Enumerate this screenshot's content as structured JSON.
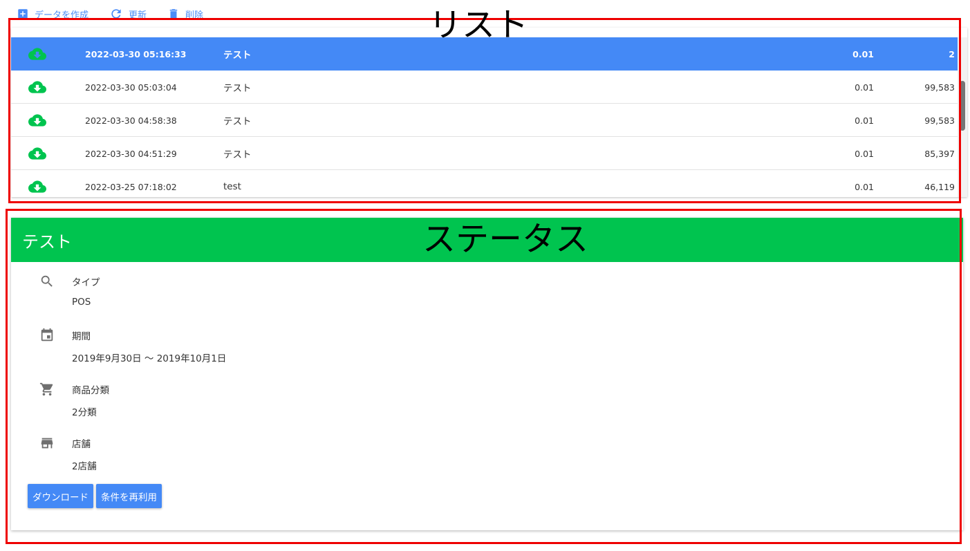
{
  "toolbar": {
    "create_label": "データを作成",
    "refresh_label": "更新",
    "delete_label": "削除"
  },
  "list": {
    "rows": [
      {
        "date": "2022-03-30 05:16:33",
        "name": "テスト",
        "value1": "0.01",
        "value2": "2",
        "selected": true
      },
      {
        "date": "2022-03-30 05:03:04",
        "name": "テスト",
        "value1": "0.01",
        "value2": "99,583"
      },
      {
        "date": "2022-03-30 04:58:38",
        "name": "テスト",
        "value1": "0.01",
        "value2": "99,583"
      },
      {
        "date": "2022-03-30 04:51:29",
        "name": "テスト",
        "value1": "0.01",
        "value2": "85,397"
      },
      {
        "date": "2022-03-25 07:18:02",
        "name": "test",
        "value1": "0.01",
        "value2": "46,119"
      }
    ]
  },
  "status": {
    "title": "テスト",
    "fields": {
      "type": {
        "label": "タイプ",
        "value": "POS"
      },
      "period": {
        "label": "期間",
        "value": "2019年9月30日 〜 2019年10月1日"
      },
      "category": {
        "label": "商品分類",
        "value": "2分類"
      },
      "store": {
        "label": "店舗",
        "value": "2店舗"
      }
    },
    "download_label": "ダウンロード",
    "reuse_label": "条件を再利用"
  },
  "annotations": {
    "list_label": "リスト",
    "status_label": "ステータス",
    "color": "#ee0000"
  },
  "colors": {
    "accent": "#4489f6",
    "status_header": "#00c44f",
    "download_icon": "#00c44f"
  },
  "icons": [
    "add-box-icon",
    "refresh-icon",
    "trash-icon",
    "cloud-download-icon",
    "search-icon",
    "calendar-icon",
    "cart-icon",
    "store-icon"
  ]
}
